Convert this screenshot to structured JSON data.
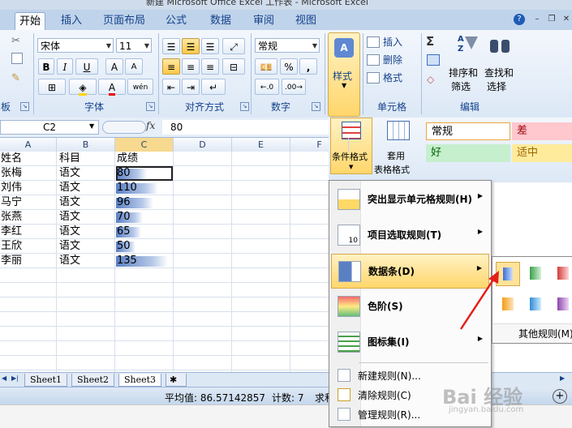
{
  "window": {
    "title": "新建 Microsoft Office Excel 工作表 - Microsoft Excel"
  },
  "tabs": [
    {
      "label": "开始",
      "active": true
    },
    {
      "label": "插入"
    },
    {
      "label": "页面布局"
    },
    {
      "label": "公式"
    },
    {
      "label": "数据"
    },
    {
      "label": "审阅"
    },
    {
      "label": "视图"
    }
  ],
  "ribbon": {
    "font_name": "宋体",
    "font_size": "11",
    "bold": "B",
    "italic": "I",
    "underline": "U",
    "grow_font": "A",
    "shrink_font": "A",
    "wen": "wén",
    "number_format": "常规",
    "percent": "%",
    "comma": ",",
    "groups": {
      "clipboard": "板",
      "font": "字体",
      "alignment": "对齐方式",
      "number": "数字",
      "styles_label": "样式",
      "cells": "单元格",
      "editing": "编辑"
    },
    "styles_button": "样式",
    "cells_insert": "插入",
    "cells_delete": "删除",
    "cells_format": "格式",
    "sigma": "Σ",
    "sort_filter_1": "排序和",
    "sort_filter_2": "筛选",
    "find_select_1": "查找和",
    "find_select_2": "选择"
  },
  "styles_panel": {
    "conditional_format_1": "条件格式",
    "table_format_1": "套用",
    "table_format_2": "表格格式",
    "normal": "常规",
    "bad": "差",
    "good": "好",
    "neutral": "适中"
  },
  "formula_bar": {
    "name_box": "C2",
    "fx": "fx",
    "value": "80"
  },
  "columns": [
    "A",
    "B",
    "C",
    "D",
    "E",
    "F"
  ],
  "table": {
    "header": [
      "姓名",
      "科目",
      "成绩"
    ],
    "rows": [
      {
        "name": "张梅",
        "subject": "语文",
        "score": 80
      },
      {
        "name": "刘伟",
        "subject": "语文",
        "score": 110
      },
      {
        "name": "马宁",
        "subject": "语文",
        "score": 96
      },
      {
        "name": "张燕",
        "subject": "语文",
        "score": 70
      },
      {
        "name": "李红",
        "subject": "语文",
        "score": 65
      },
      {
        "name": "王欣",
        "subject": "语文",
        "score": 50
      },
      {
        "name": "李丽",
        "subject": "语文",
        "score": 135
      }
    ]
  },
  "sheets": [
    "Sheet1",
    "Sheet2",
    "Sheet3"
  ],
  "active_sheet": "Sheet3",
  "status": {
    "average": "平均值: 86.57142857",
    "count": "计数: 7",
    "sum_partial": "求和"
  },
  "menu": {
    "items": [
      {
        "label": "突出显示单元格规则(H)"
      },
      {
        "label": "项目选取规则(T)"
      },
      {
        "label": "数据条(D)",
        "selected": true
      },
      {
        "label": "色阶(S)"
      },
      {
        "label": "图标集(I)"
      }
    ],
    "secondary": [
      {
        "label": "新建规则(N)..."
      },
      {
        "label": "清除规则(C)"
      },
      {
        "label": "管理规则(R)..."
      }
    ]
  },
  "gallery": {
    "more_rules": "其他规则(M)..."
  },
  "watermark": {
    "text": "Bai 经验",
    "sub": "jingyan.baidu.com"
  },
  "colors": {
    "accent": "#15428b",
    "selected": "#ffd66b",
    "databar": "#5a7fc3"
  }
}
